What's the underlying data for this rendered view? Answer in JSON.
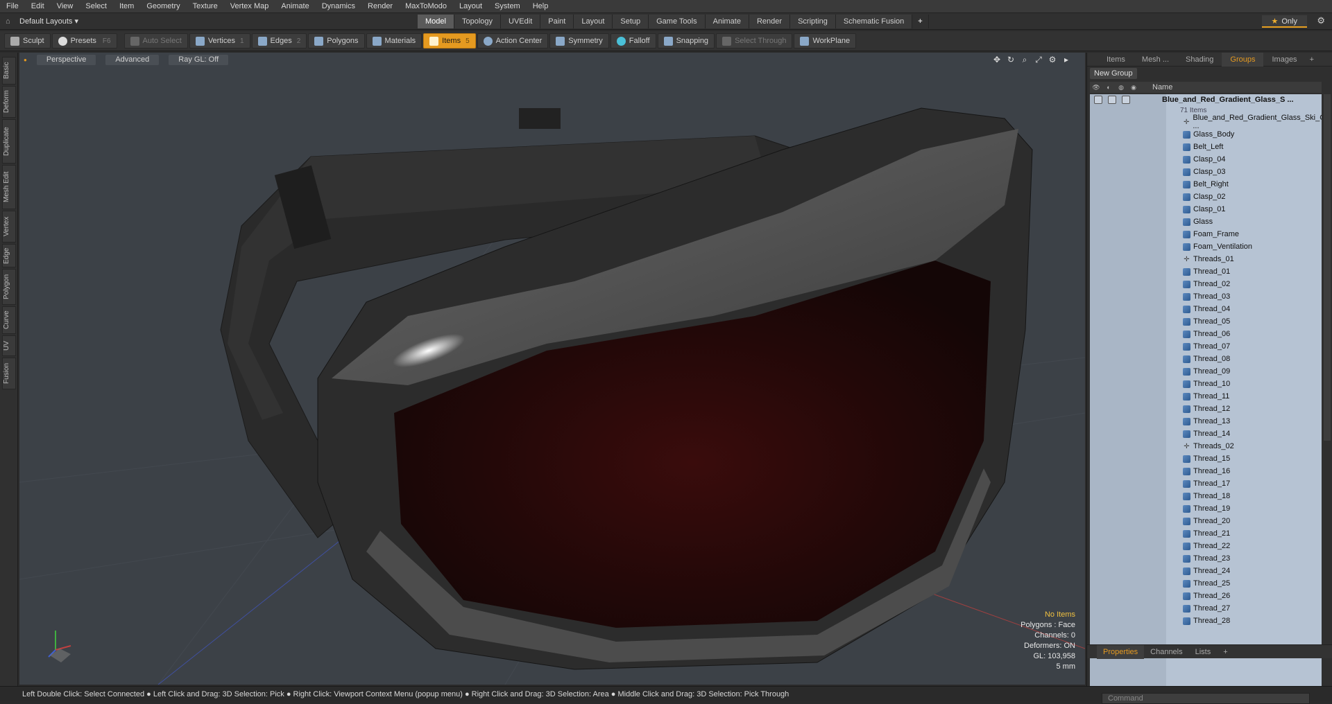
{
  "menu": [
    "File",
    "Edit",
    "View",
    "Select",
    "Item",
    "Geometry",
    "Texture",
    "Vertex Map",
    "Animate",
    "Dynamics",
    "Render",
    "MaxToModo",
    "Layout",
    "System",
    "Help"
  ],
  "layouts": {
    "label": "Default Layouts ▾"
  },
  "mode_tabs": [
    "Model",
    "Topology",
    "UVEdit",
    "Paint",
    "Layout",
    "Setup",
    "Game Tools",
    "Animate",
    "Render",
    "Scripting",
    "Schematic Fusion"
  ],
  "active_mode_tab": "Model",
  "only_label": "Only",
  "toolbar": {
    "sculpt": "Sculpt",
    "presets": "Presets",
    "presets_key": "F6",
    "auto_select": "Auto Select",
    "vertices": "Vertices",
    "vertices_count": "1",
    "edges": "Edges",
    "edges_count": "2",
    "polygons": "Polygons",
    "materials": "Materials",
    "items": "Items",
    "items_count": "5",
    "action_center": "Action Center",
    "symmetry": "Symmetry",
    "falloff": "Falloff",
    "snapping": "Snapping",
    "select_through": "Select Through",
    "workplane": "WorkPlane"
  },
  "left_tabs": [
    "Basic",
    "Deform",
    "Duplicate",
    "Mesh Edit",
    "Vertex",
    "Edge",
    "Polygon",
    "Curve",
    "UV",
    "Fusion"
  ],
  "viewport": {
    "perspective": "Perspective",
    "advanced": "Advanced",
    "raygl": "Ray GL: Off",
    "info": {
      "no_items": "No Items",
      "polygons": "Polygons : Face",
      "channels": "Channels: 0",
      "deformers": "Deformers: ON",
      "gl": "GL: 103,958",
      "unit": "5 mm"
    }
  },
  "right_panel": {
    "tabs": [
      "Items",
      "Mesh ...",
      "Shading",
      "Groups",
      "Images"
    ],
    "active_tab": "Groups",
    "new_group": "New Group",
    "name_header": "Name",
    "group_name": "Blue_and_Red_Gradient_Glass_S ...",
    "group_count": "71 Items",
    "items": [
      {
        "name": "Blue_and_Red_Gradient_Glass_Ski_G ...",
        "type": "locator"
      },
      {
        "name": "Glass_Body",
        "type": "mesh"
      },
      {
        "name": "Belt_Left",
        "type": "mesh"
      },
      {
        "name": "Clasp_04",
        "type": "mesh"
      },
      {
        "name": "Clasp_03",
        "type": "mesh"
      },
      {
        "name": "Belt_Right",
        "type": "mesh"
      },
      {
        "name": "Clasp_02",
        "type": "mesh"
      },
      {
        "name": "Clasp_01",
        "type": "mesh"
      },
      {
        "name": "Glass",
        "type": "mesh"
      },
      {
        "name": "Foam_Frame",
        "type": "mesh"
      },
      {
        "name": "Foam_Ventilation",
        "type": "mesh"
      },
      {
        "name": "Threads_01",
        "type": "locator"
      },
      {
        "name": "Thread_01",
        "type": "mesh"
      },
      {
        "name": "Thread_02",
        "type": "mesh"
      },
      {
        "name": "Thread_03",
        "type": "mesh"
      },
      {
        "name": "Thread_04",
        "type": "mesh"
      },
      {
        "name": "Thread_05",
        "type": "mesh"
      },
      {
        "name": "Thread_06",
        "type": "mesh"
      },
      {
        "name": "Thread_07",
        "type": "mesh"
      },
      {
        "name": "Thread_08",
        "type": "mesh"
      },
      {
        "name": "Thread_09",
        "type": "mesh"
      },
      {
        "name": "Thread_10",
        "type": "mesh"
      },
      {
        "name": "Thread_11",
        "type": "mesh"
      },
      {
        "name": "Thread_12",
        "type": "mesh"
      },
      {
        "name": "Thread_13",
        "type": "mesh"
      },
      {
        "name": "Thread_14",
        "type": "mesh"
      },
      {
        "name": "Threads_02",
        "type": "locator"
      },
      {
        "name": "Thread_15",
        "type": "mesh"
      },
      {
        "name": "Thread_16",
        "type": "mesh"
      },
      {
        "name": "Thread_17",
        "type": "mesh"
      },
      {
        "name": "Thread_18",
        "type": "mesh"
      },
      {
        "name": "Thread_19",
        "type": "mesh"
      },
      {
        "name": "Thread_20",
        "type": "mesh"
      },
      {
        "name": "Thread_21",
        "type": "mesh"
      },
      {
        "name": "Thread_22",
        "type": "mesh"
      },
      {
        "name": "Thread_23",
        "type": "mesh"
      },
      {
        "name": "Thread_24",
        "type": "mesh"
      },
      {
        "name": "Thread_25",
        "type": "mesh"
      },
      {
        "name": "Thread_26",
        "type": "mesh"
      },
      {
        "name": "Thread_27",
        "type": "mesh"
      },
      {
        "name": "Thread_28",
        "type": "mesh"
      }
    ],
    "bottom_tabs": [
      "Properties",
      "Channels",
      "Lists"
    ],
    "active_bottom_tab": "Properties",
    "command_placeholder": "Command"
  },
  "status": "Left Double Click: Select Connected ● Left Click and Drag: 3D Selection: Pick ● Right Click: Viewport Context Menu (popup menu) ● Right Click and Drag: 3D Selection: Area ● Middle Click and Drag: 3D Selection: Pick Through",
  "colors": {
    "accent": "#e59a20",
    "list_bg": "#b6c3d3",
    "viewport_bg": "#3c4147"
  }
}
